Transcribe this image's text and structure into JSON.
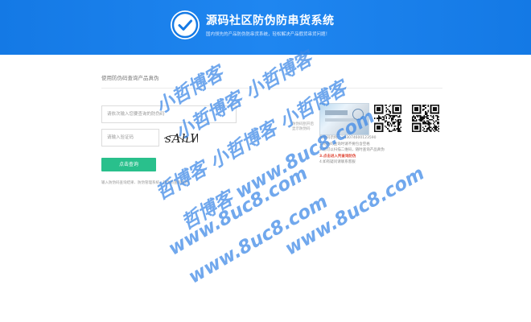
{
  "header": {
    "title": "源码社区防伪防串货系统",
    "subtitle": "国内领先的产品防伪防串货系统，轻松解决产品假货串货问题！"
  },
  "query_panel": {
    "heading": "使用防伪码查询产品真伪",
    "code_placeholder": "请依次输入您要查询的防伪码",
    "captcha_placeholder": "请输入验证码",
    "captcha_text": "sAhW",
    "query_button": "点击查询",
    "result_note": "输入防伪码查询结果、防伪管理系统、防伪码查询提示"
  },
  "sample_panel": {
    "side_note": [
      "防伪码刮开后",
      "显示防伪码"
    ],
    "info_lines": [
      "防伪码示例：3N3074600123590",
      "1.防伪码查询时请不要包含空格",
      "2.您可以扫描二维码，随时查询产品真伪",
      "3.点击进入判查询防伪",
      "4.如有疑问请联系客服"
    ]
  },
  "watermarks": [
    "小哲博客",
    "小哲博客 小哲博客",
    "哲博客 小哲博客 小哲博客",
    "哲博客 www.8uc8.com",
    "www.8uc8.com",
    "www.8uc8.com",
    "www.8uc8.com"
  ],
  "colors": {
    "header_bg": "#1479e5",
    "button_bg": "#29c08c",
    "watermark": "#3a86e6",
    "emphasis": "#e04b3a"
  },
  "icons": {
    "logo": "check-circle-icon",
    "qr_codes": [
      "qr-code-icon",
      "qr-code-icon"
    ]
  }
}
